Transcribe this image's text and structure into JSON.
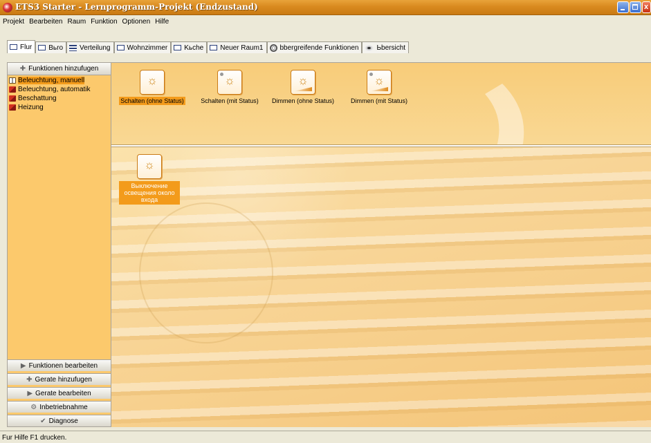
{
  "window": {
    "title": "ETS3 Starter - Lernprogramm-Projekt (Endzustand)"
  },
  "menu": [
    "Projekt",
    "Bearbeiten",
    "Raum",
    "Funktion",
    "Optionen",
    "Hilfe"
  ],
  "tabs": [
    {
      "label": "Flur",
      "icon": "room-icon",
      "active": true
    },
    {
      "label": "Bьro",
      "icon": "room-icon"
    },
    {
      "label": "Verteilung",
      "icon": "distribution-icon"
    },
    {
      "label": "Wohnzimmer",
      "icon": "room-icon"
    },
    {
      "label": "Kьche",
      "icon": "room-icon"
    },
    {
      "label": "Neuer Raum1",
      "icon": "room-icon"
    },
    {
      "label": "bbergreifende Funktionen",
      "icon": "global-functions-icon"
    },
    {
      "label": "Ьbersicht",
      "icon": "overview-eye-icon"
    }
  ],
  "sidebar": {
    "header": "Funktionen hinzufugen",
    "tree": [
      {
        "label": "Beleuchtung, manuell",
        "selected": true,
        "icon": "open-book-icon"
      },
      {
        "label": "Beleuchtung, automatik",
        "icon": "book-icon"
      },
      {
        "label": "Beschattung",
        "icon": "book-icon"
      },
      {
        "label": "Heizung",
        "icon": "book-icon"
      }
    ],
    "buttons": [
      {
        "label": "Funktionen bearbeiten",
        "icon": "play-arrow-icon"
      },
      {
        "label": "Gerate hinzufugen",
        "icon": "add-device-icon"
      },
      {
        "label": "Gerate bearbeiten",
        "icon": "play-arrow-icon"
      },
      {
        "label": "Inbetriebnahme",
        "icon": "commissioning-icon"
      },
      {
        "label": "Diagnose",
        "icon": "diagnose-icon"
      }
    ]
  },
  "palette": [
    {
      "label": "Schalten (ohne Status)",
      "selected": true,
      "icon": "switch-light-icon"
    },
    {
      "label": "Schalten (mit Status)",
      "icon": "switch-light-status-icon"
    },
    {
      "label": "Dimmen (ohne Status)",
      "icon": "dim-light-icon"
    },
    {
      "label": "Dimmen (mit Status)",
      "icon": "dim-light-status-icon"
    }
  ],
  "room_functions": [
    {
      "label": "Выключение освещения около входа",
      "icon": "switch-light-icon"
    }
  ],
  "statusbar": {
    "text": "Fur Hilfe F1 drucken."
  },
  "colors": {
    "title_bar": "#d98a1f",
    "panel_bg": "#f8cc79",
    "selection": "#f39b1b"
  }
}
